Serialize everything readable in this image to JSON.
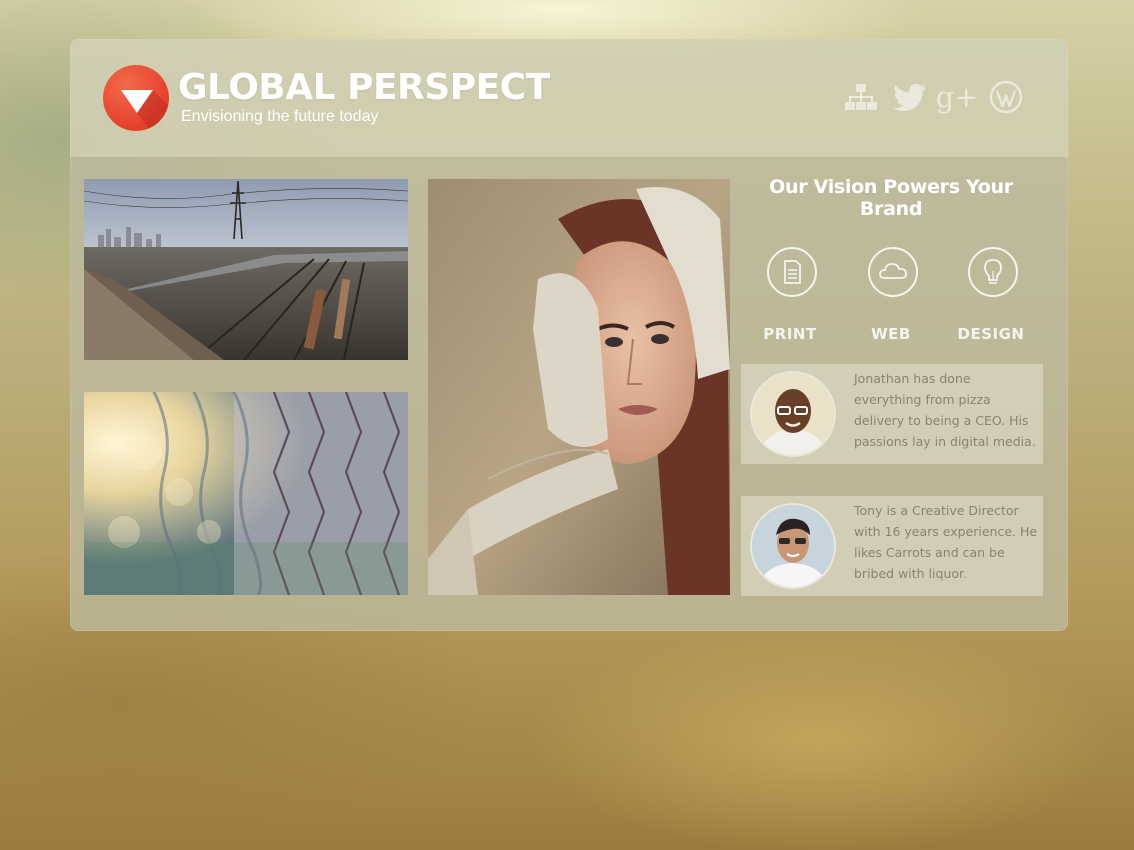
{
  "header": {
    "logo_icon": "down-triangle-logo-icon",
    "title": "GLOBAL PERSPECT",
    "tagline": "Envisioning the future today",
    "social_icons": [
      "sitemap-icon",
      "twitter-icon",
      "google-plus-icon",
      "wordpress-icon"
    ],
    "google_plus_glyph": "g+"
  },
  "gallery": {
    "images": [
      "city-railway-photo",
      "chain-link-fence-photo",
      "woman-portrait-photo"
    ]
  },
  "sidebar": {
    "title": "Our Vision Powers Your Brand",
    "services": [
      {
        "label": "PRINT",
        "icon": "document-icon"
      },
      {
        "label": "WEB",
        "icon": "cloud-icon"
      },
      {
        "label": "DESIGN",
        "icon": "lightbulb-icon"
      }
    ],
    "bios": [
      {
        "text": "Jonathan has done everything from pizza delivery to being a CEO. His passions lay in digital media.",
        "avatar": "jonathan-avatar"
      },
      {
        "text": "Tony is a Creative Director with 16 years experience. He likes Carrots and can be bribed with liquor.",
        "avatar": "tony-avatar"
      }
    ]
  },
  "colors": {
    "accent": "#e4402c",
    "panel": "#bebaa0",
    "text_light": "#ffffff",
    "bio_text": "#8a8469"
  }
}
